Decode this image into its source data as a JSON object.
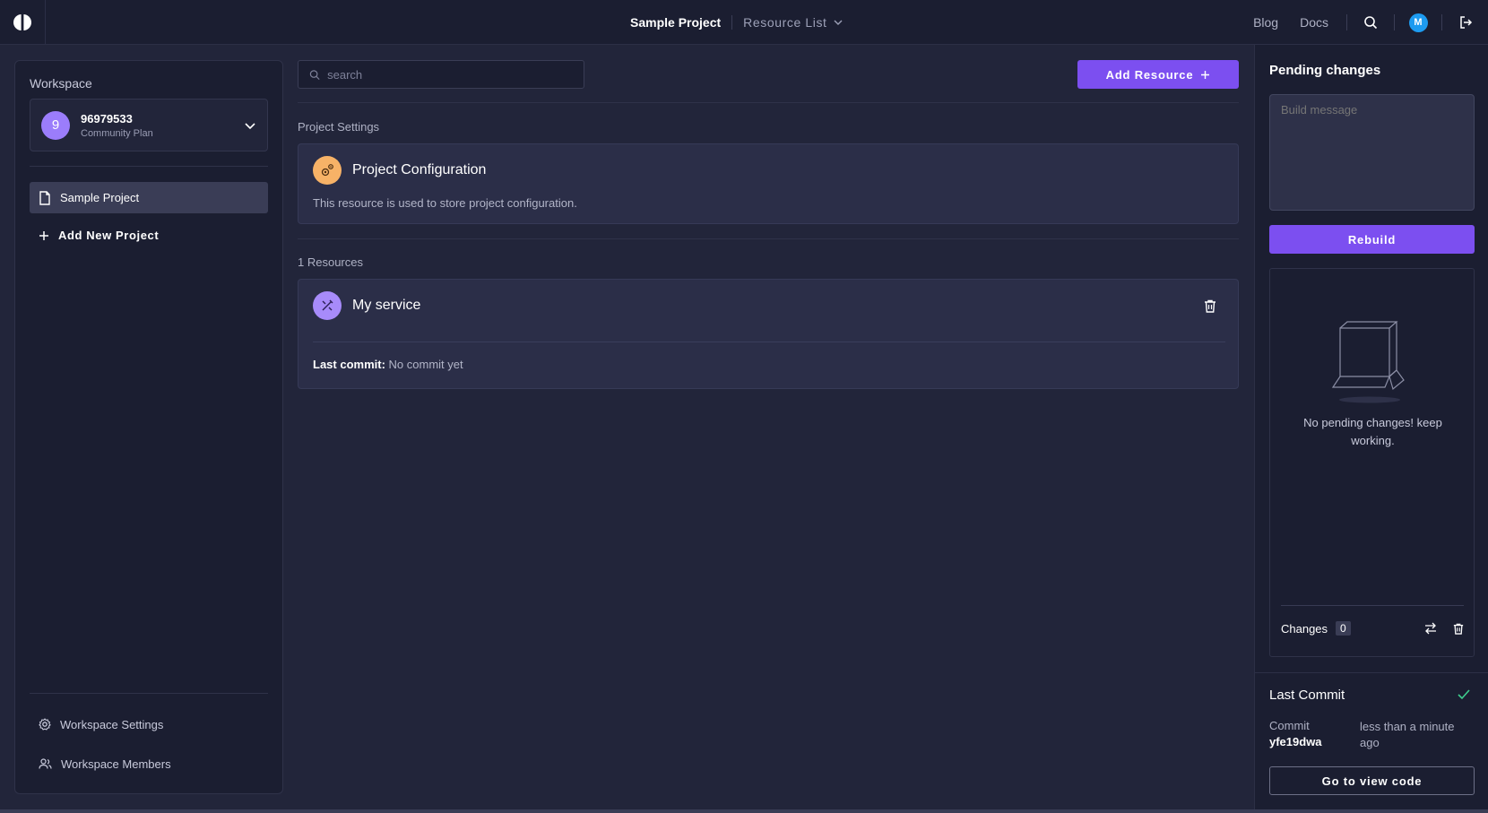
{
  "header": {
    "project": "Sample Project",
    "resource_list": "Resource List",
    "links": {
      "blog": "Blog",
      "docs": "Docs"
    },
    "avatar_initial": "M"
  },
  "sidebar": {
    "workspace_label": "Workspace",
    "workspace": {
      "initial": "9",
      "name": "96979533",
      "plan": "Community Plan"
    },
    "projects": [
      {
        "label": "Sample Project"
      }
    ],
    "add_project": "Add New Project",
    "settings": "Workspace Settings",
    "members": "Workspace Members"
  },
  "main": {
    "search_placeholder": "search",
    "add_resource": "Add Resource",
    "project_settings_label": "Project Settings",
    "config_card": {
      "title": "Project Configuration",
      "description": "This resource is used to store project configuration."
    },
    "resources_label": "1 Resources",
    "resources": [
      {
        "title": "My service",
        "last_commit_label": "Last commit:",
        "last_commit_value": "No commit yet"
      }
    ]
  },
  "right_panel": {
    "title": "Pending changes",
    "build_placeholder": "Build message",
    "rebuild": "Rebuild",
    "empty_message": "No pending changes! keep working.",
    "changes_label": "Changes",
    "changes_count": "0",
    "last_commit_title": "Last Commit",
    "commit_label": "Commit",
    "commit_hash": "yfe19dwa",
    "commit_time": "less than a minute ago",
    "view_code": "Go to view code"
  },
  "colors": {
    "accent": "#7c4ff0",
    "background": "#22253a",
    "panel": "#1b1e31",
    "config_icon": "#f7b267",
    "service_icon": "#a78bfa",
    "success": "#3ecf8e"
  },
  "icons": {
    "logo": "logo-icon",
    "search": "search-icon",
    "logout": "logout-icon",
    "chevron": "chevron-down-icon",
    "file": "file-icon",
    "plus": "plus-icon",
    "gear": "gear-icon",
    "users": "users-icon",
    "trash": "trash-icon",
    "swap": "swap-icon",
    "check": "check-icon",
    "box": "box-illustration"
  }
}
